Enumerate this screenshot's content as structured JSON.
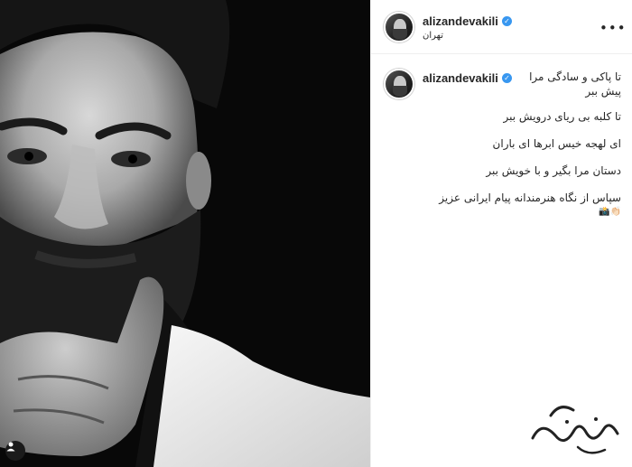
{
  "post": {
    "username": "alizandevakili",
    "location": "تهران",
    "caption_lines": [
      "تا پاکی و سادگی مرا",
      "پیش ببر",
      "تا کلبه بی ریای درویش ببر",
      "ای لهجه خیس ابرها ای باران",
      "دستان مرا بگیر و با خویش ببر",
      "سپاس از نگاه هنرمندانه پیام ایرانی عزیز",
      "👏🏻📸"
    ]
  },
  "icons": {
    "verified": "verified-badge-icon",
    "more": "more-options-icon",
    "tag": "user-tag-icon"
  },
  "watermark_text": "آوایکس",
  "colors": {
    "verified_blue": "#3897f0",
    "text": "#262626",
    "divider": "#efefef"
  }
}
